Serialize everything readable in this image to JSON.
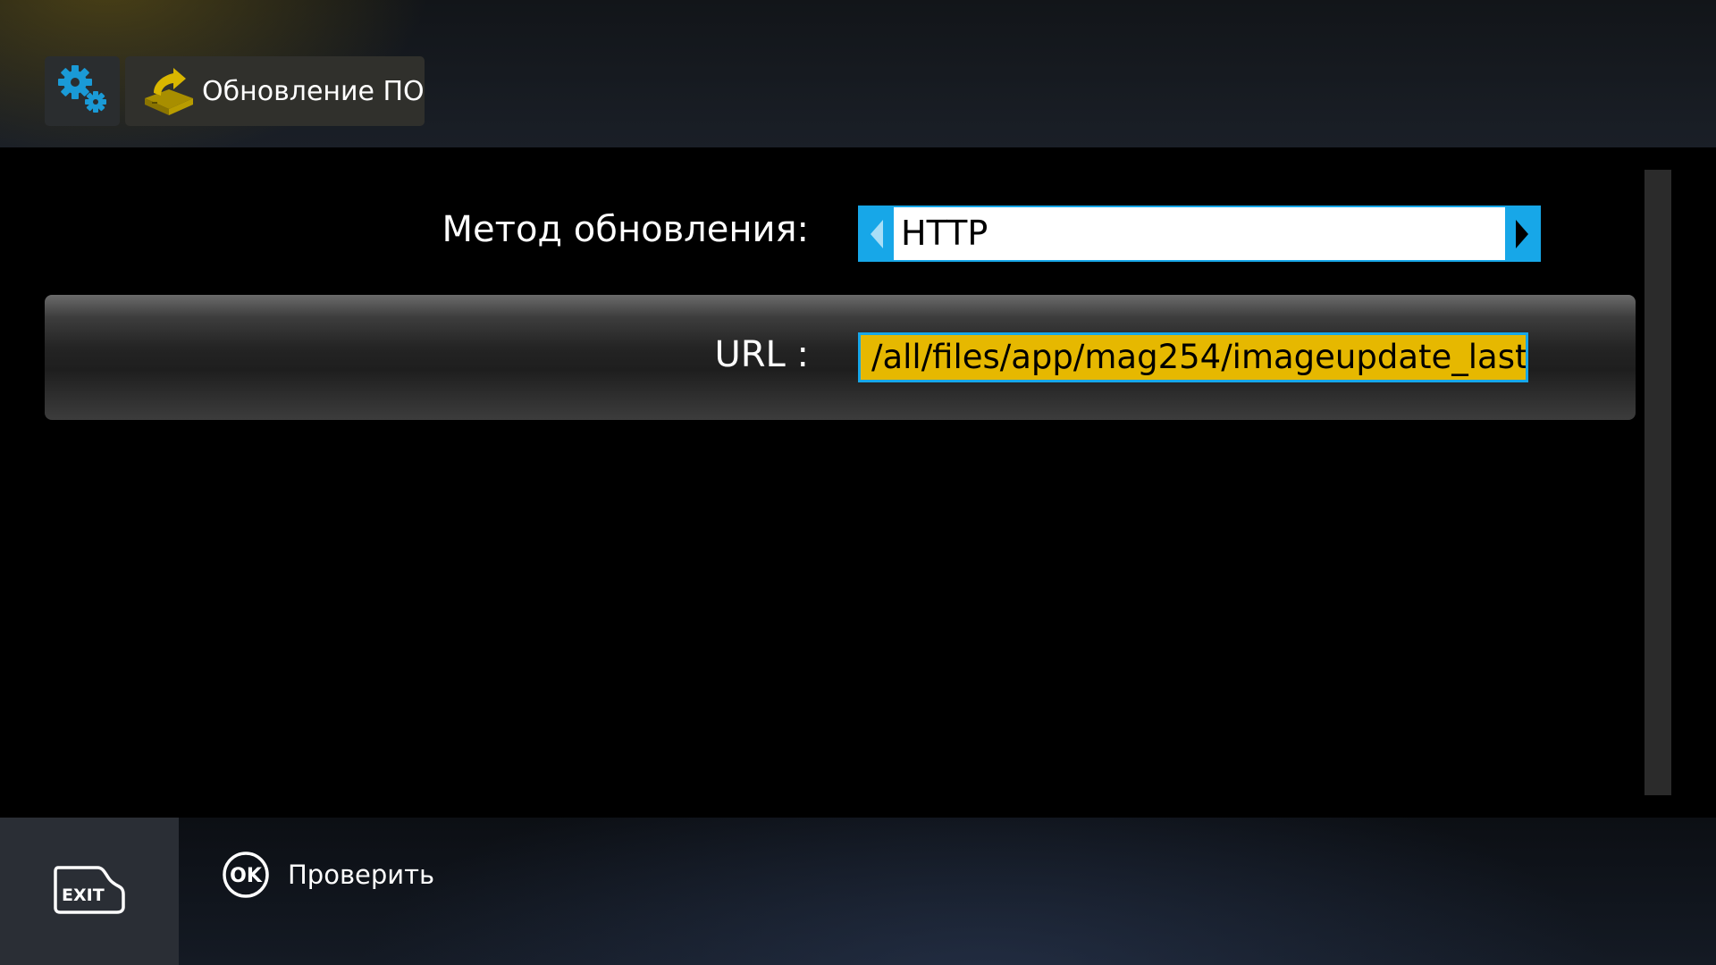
{
  "header": {
    "settings_icon": "gears-icon",
    "package_icon": "software-update-box-icon",
    "title": "Обновление ПО"
  },
  "form": {
    "method": {
      "label": "Метод обновления:",
      "value": "HTTP",
      "left_arrow_icon": "arrow-left-icon",
      "right_arrow_icon": "arrow-right-icon"
    },
    "url": {
      "label": "URL :",
      "value": "/all/files/app/mag254/imageupdate_last"
    }
  },
  "footer": {
    "exit_key": {
      "icon": "exit-key-icon",
      "label": "EXIT"
    },
    "ok_hint": {
      "icon": "ok-key-icon",
      "key_label": "OK",
      "text": "Проверить"
    }
  },
  "colors": {
    "accent_blue": "#17a7e8",
    "url_field_yellow": "#e6b800",
    "gear_blue": "#1a9ad6",
    "package_gold": "#c9a800"
  }
}
